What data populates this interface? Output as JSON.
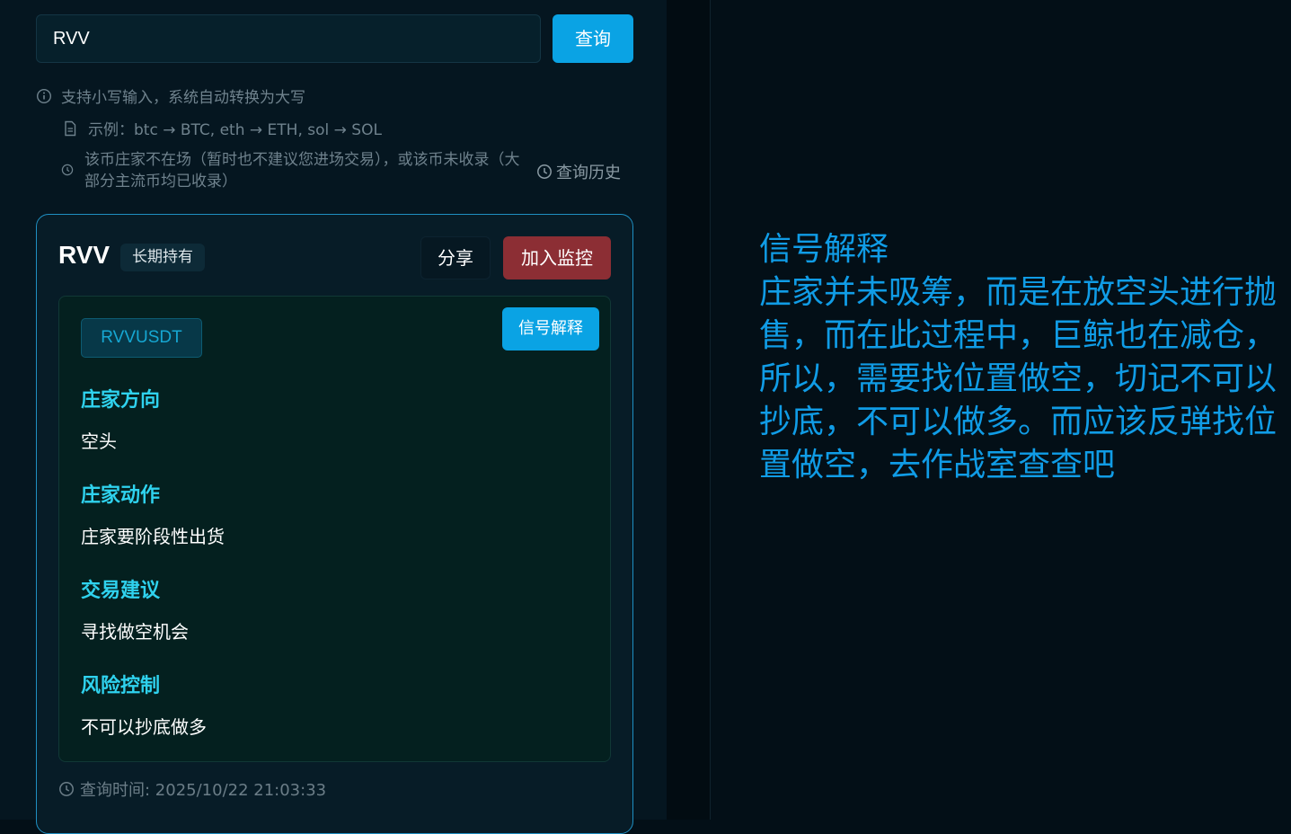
{
  "search": {
    "value": "RVV",
    "button_label": "查询"
  },
  "hints": {
    "lowercase": "支持小写输入，系统自动转换为大写",
    "example": "示例：btc → BTC, eth → ETH, sol → SOL",
    "not_listed": "该币庄家不在场（暂时也不建议您进场交易），或该币未收录（大部分主流币均已收录）",
    "history_label": "查询历史"
  },
  "result": {
    "symbol": "RVV",
    "badge": "长期持有",
    "share_label": "分享",
    "monitor_label": "加入监控",
    "pair": "RVVUSDT",
    "explain_button": "信号解释",
    "sections": [
      {
        "title": "庄家方向",
        "value": "空头"
      },
      {
        "title": "庄家动作",
        "value": "庄家要阶段性出货"
      },
      {
        "title": "交易建议",
        "value": "寻找做空机会"
      },
      {
        "title": "风险控制",
        "value": "不可以抄底做多"
      }
    ],
    "query_time": "查询时间: 2025/10/22 21:03:33"
  },
  "explanation": {
    "title": "信号解释",
    "body": "庄家并未吸筹，而是在放空头进行抛售，而在此过程中，巨鲸也在减仓，所以，需要找位置做空，切记不可以抄底，不可以做多。而应该反弹找位置做空，去作战室查查吧"
  },
  "colors": {
    "accent": "#0aa3e4",
    "danger": "#8c2e34",
    "section_title": "#2fd2ee",
    "explain_text": "#109ce6"
  }
}
